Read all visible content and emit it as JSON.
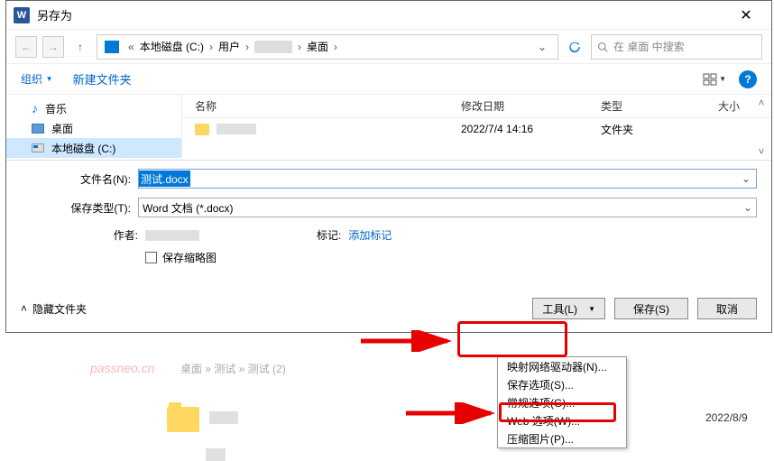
{
  "titlebar": {
    "title": "另存为"
  },
  "breadcrumb": {
    "seg1": "本地磁盘 (C:)",
    "seg2": "用户",
    "seg3": "桌面"
  },
  "search": {
    "placeholder": "在 桌面 中搜索"
  },
  "toolbar": {
    "organize": "组织",
    "newfolder": "新建文件夹"
  },
  "sidebar": {
    "music": "音乐",
    "desktop": "桌面",
    "disk": "本地磁盘 (C:)"
  },
  "columns": {
    "name": "名称",
    "date": "修改日期",
    "type": "类型",
    "size": "大小"
  },
  "filerow": {
    "date": "2022/7/4 14:16",
    "type": "文件夹"
  },
  "form": {
    "filename_label": "文件名(N):",
    "filename_value": "测试.docx",
    "filetype_label": "保存类型(T):",
    "filetype_value": "Word 文档 (*.docx)",
    "author_label": "作者:",
    "tags_label": "标记:",
    "tags_link": "添加标记",
    "thumb": "保存缩略图"
  },
  "bottom": {
    "hide": "隐藏文件夹",
    "tools": "工具(L)",
    "save": "保存(S)",
    "cancel": "取消"
  },
  "menu": {
    "m1": "映射网络驱动器(N)...",
    "m2": "保存选项(S)...",
    "m3": "常规选项(G)...",
    "m4": "Web 选项(W)...",
    "m5": "压缩图片(P)..."
  },
  "background": {
    "watermark": "passneo.cn",
    "path": "桌面 » 测试 » 测试 (2)",
    "date": "2022/8/9"
  }
}
